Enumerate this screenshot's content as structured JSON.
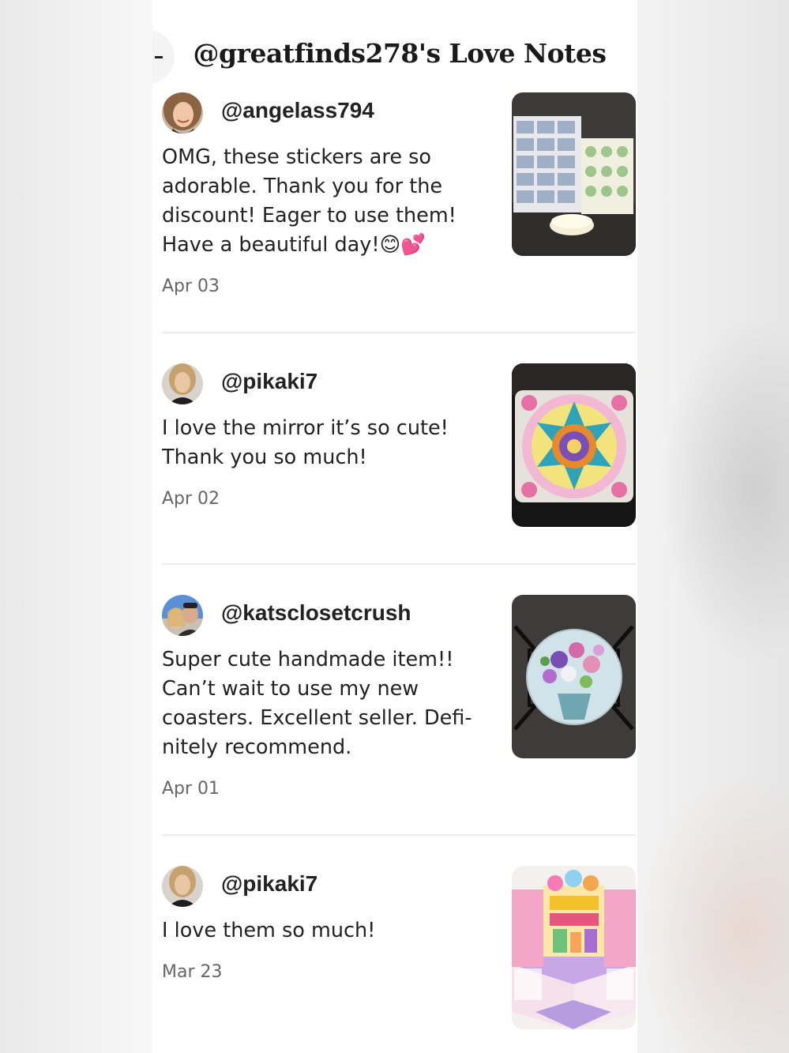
{
  "page": {
    "title": "@greatfinds278's Love Notes",
    "back_label": "-"
  },
  "notes": [
    {
      "username": "@angelass794",
      "message": "OMG, these stickers are so\nadorable. Thank you for the\ndiscount! Eager to use them!\nHave a beautiful day!😊💕",
      "date": "Apr 03",
      "photo_icon": "stickers-photo"
    },
    {
      "username": "@pikaki7",
      "message": "I love the mirror it’s so cute!\nThank you so much!",
      "date": "Apr 02",
      "photo_icon": "mandala-mirror-photo"
    },
    {
      "username": "@katsclosetcrush",
      "message": "Super cute handmade item!!\nCan’t wait to use my new\ncoasters. Excellent seller. Defi-\nnitely recommend.",
      "date": "Apr 01",
      "photo_icon": "floral-coaster-photo"
    },
    {
      "username": "@pikaki7",
      "message": "I love them so much!",
      "date": "Mar 23",
      "photo_icon": "birthday-popup-card-photo"
    }
  ]
}
